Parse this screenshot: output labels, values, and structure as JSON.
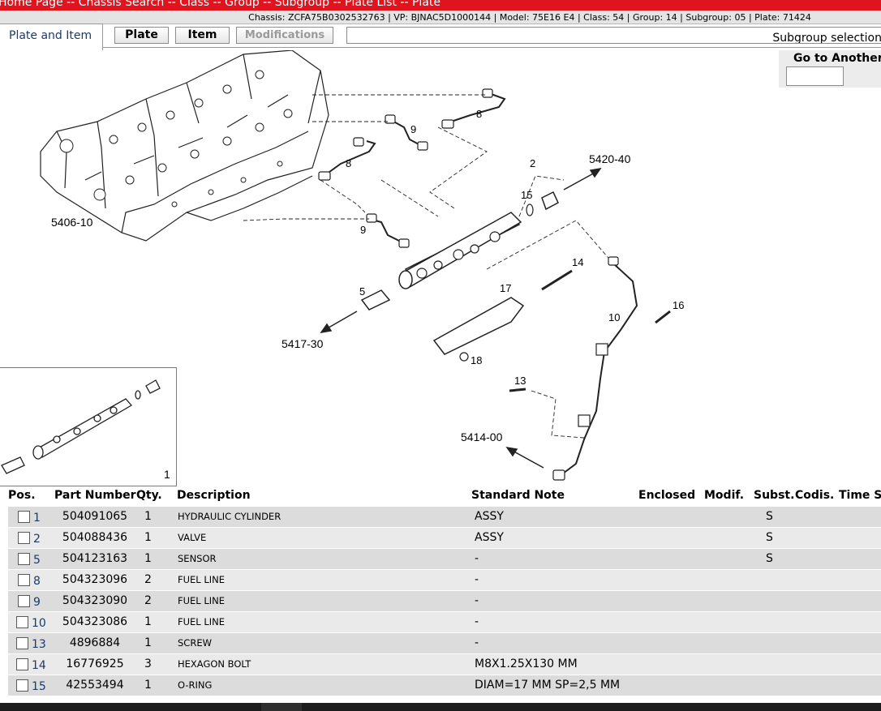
{
  "nav": {
    "breadcrumb": "Home Page -- Chassis Search -- Class -- Group -- Subgroup -- Plate List -- Plate"
  },
  "info": {
    "text": "Chassis: ZCFA75B0302532763 | VP: BJNAC5D1000144 | Model: 75E16 E4 | Class: 54 | Group: 14 | Subgroup: 05 | Plate: 71424"
  },
  "tabs": {
    "plate_and_item": "Plate and Item",
    "plate": "Plate",
    "item": "Item",
    "modifications": "Modifications",
    "subgroup_selection": "Subgroup selection"
  },
  "goto": {
    "label": "Go to Another"
  },
  "diagram": {
    "refs": {
      "r5406": "5406-10",
      "r5420": "5420-40",
      "r5417": "5417-30",
      "r5414": "5414-00"
    },
    "callouts": [
      "2",
      "5",
      "8",
      "8",
      "9",
      "9",
      "10",
      "13",
      "14",
      "15",
      "16",
      "17",
      "18"
    ],
    "thumb_number": "1"
  },
  "table": {
    "headers": {
      "pos": "Pos.",
      "part_number": "Part Number",
      "qty": "Qty.",
      "description": "Description",
      "standard_note": "Standard Note",
      "enclosed": "Enclosed",
      "modif": "Modif.",
      "subst": "Subst.",
      "codis": "Codis.",
      "time": "Time S"
    },
    "rows": [
      {
        "pos": "1",
        "part": "504091065",
        "qty": "1",
        "desc": "HYDRAULIC CYLINDER",
        "note": "ASSY",
        "subst": "S"
      },
      {
        "pos": "2",
        "part": "504088436",
        "qty": "1",
        "desc": "VALVE",
        "note": "ASSY",
        "subst": "S"
      },
      {
        "pos": "5",
        "part": "504123163",
        "qty": "1",
        "desc": "SENSOR",
        "note": "-",
        "subst": "S"
      },
      {
        "pos": "8",
        "part": "504323096",
        "qty": "2",
        "desc": "FUEL LINE",
        "note": "-",
        "subst": ""
      },
      {
        "pos": "9",
        "part": "504323090",
        "qty": "2",
        "desc": "FUEL LINE",
        "note": "-",
        "subst": ""
      },
      {
        "pos": "10",
        "part": "504323086",
        "qty": "1",
        "desc": "FUEL LINE",
        "note": "-",
        "subst": ""
      },
      {
        "pos": "13",
        "part": "4896884",
        "qty": "1",
        "desc": "SCREW",
        "note": "-",
        "subst": ""
      },
      {
        "pos": "14",
        "part": "16776925",
        "qty": "3",
        "desc": "HEXAGON BOLT",
        "note": "M8X1.25X130 MM",
        "subst": ""
      },
      {
        "pos": "15",
        "part": "42553494",
        "qty": "1",
        "desc": "O-RING",
        "note": "DIAM=17 MM SP=2,5 MM",
        "subst": ""
      }
    ]
  },
  "colors": {
    "top_bar": "#e0141e",
    "info_bar": "#e4e4e4",
    "row_dark": "#dcdcdc",
    "row_light": "#eaeaea",
    "link": "#1c3a6e"
  }
}
